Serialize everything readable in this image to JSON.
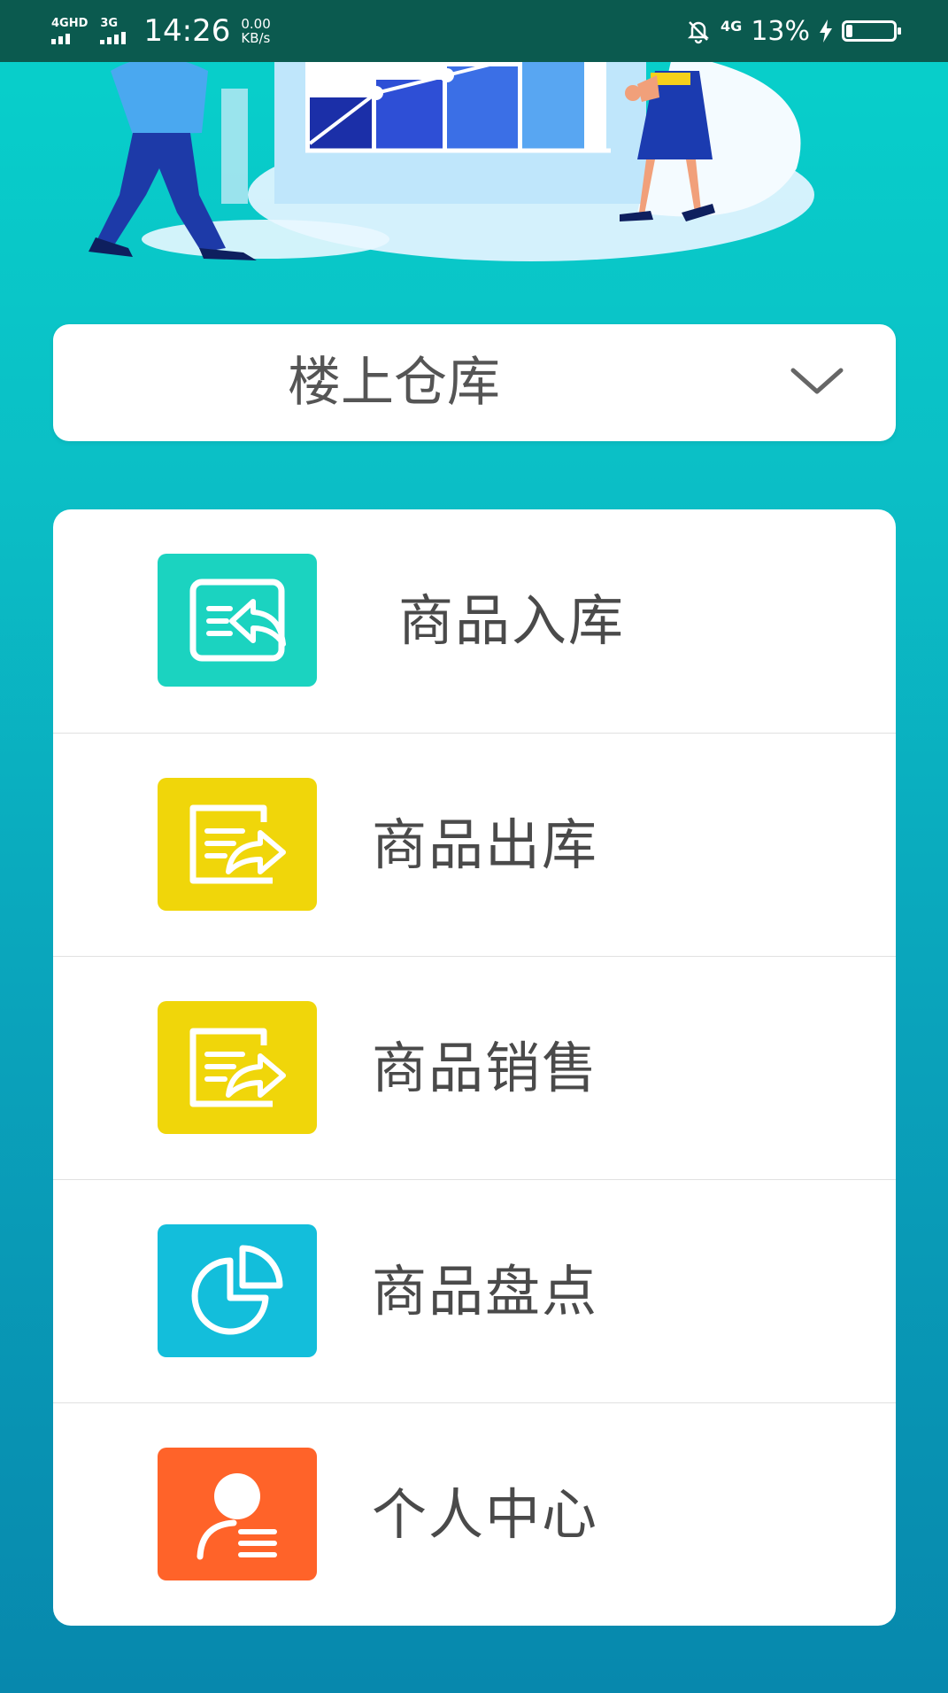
{
  "status_bar": {
    "sim1_label": "4GHD",
    "sim2_label": "3G",
    "time": "14:26",
    "speed_value": "0.00",
    "speed_unit": "KB/s",
    "network_label": "4G",
    "battery_percent": "13%",
    "battery_level": 0.13
  },
  "warehouse_selector": {
    "selected": "楼上仓库"
  },
  "menu": {
    "items": [
      {
        "label": "商品入库",
        "icon": "inbound-document-icon",
        "color": "#1bd3c0"
      },
      {
        "label": "商品出库",
        "icon": "outbound-document-icon",
        "color": "#f0d60a"
      },
      {
        "label": "商品销售",
        "icon": "sales-document-icon",
        "color": "#f0d60a"
      },
      {
        "label": "商品盘点",
        "icon": "pie-chart-icon",
        "color": "#13bedb"
      },
      {
        "label": "个人中心",
        "icon": "user-profile-icon",
        "color": "#ff6329"
      }
    ]
  }
}
